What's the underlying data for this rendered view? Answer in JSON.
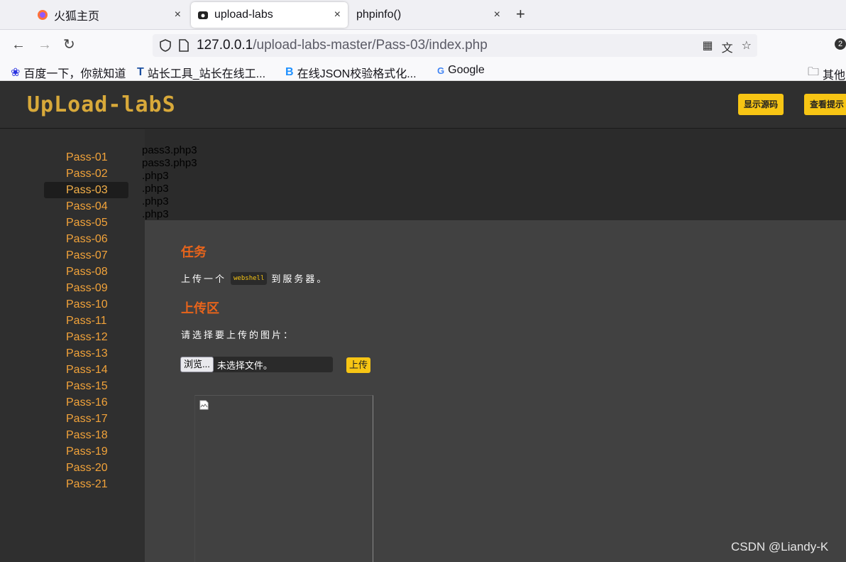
{
  "browser": {
    "tabs": [
      {
        "label": "火狐主页",
        "close": "×"
      },
      {
        "label": "upload-labs",
        "close": "×"
      },
      {
        "label": "phpinfo()",
        "close": "×"
      }
    ],
    "new_tab": "+",
    "url_host": "127.0.0.1",
    "url_rest": "/upload-labs-master/Pass-03/index.php",
    "badge": "2",
    "bookmarks": [
      {
        "label": "百度一下，你就知道"
      },
      {
        "label": "站长工具_站长在线工..."
      },
      {
        "label": "在线JSON校验格式化..."
      },
      {
        "label": "Google"
      }
    ],
    "bookmarks_other": "其他书"
  },
  "header": {
    "logo": "UpLoad-labS",
    "show_source": "显示源码",
    "view_hint": "查看提示"
  },
  "sidebar": {
    "items": [
      "Pass-01",
      "Pass-02",
      "Pass-03",
      "Pass-04",
      "Pass-05",
      "Pass-06",
      "Pass-07",
      "Pass-08",
      "Pass-09",
      "Pass-10",
      "Pass-11",
      "Pass-12",
      "Pass-13",
      "Pass-14",
      "Pass-15",
      "Pass-16",
      "Pass-17",
      "Pass-18",
      "Pass-19",
      "Pass-20",
      "Pass-21"
    ],
    "active": "Pass-03"
  },
  "echo_lines": [
    "pass3.php3",
    "pass3.php3",
    ".php3",
    ".php3",
    ".php3",
    ".php3"
  ],
  "main": {
    "task_heading": "任务",
    "task_prefix": "上传一个",
    "task_code": "webshell",
    "task_suffix": "到服务器。",
    "upload_heading": "上传区",
    "choose_label": "请选择要上传的图片：",
    "browse_label": "浏览...",
    "no_file": "未选择文件。",
    "upload_button": "上传"
  },
  "watermark": "CSDN @Liandy-K",
  "colors": {
    "accent": "#f7c514",
    "heading": "#e8641b",
    "sidebar_link": "#f2a33a"
  }
}
